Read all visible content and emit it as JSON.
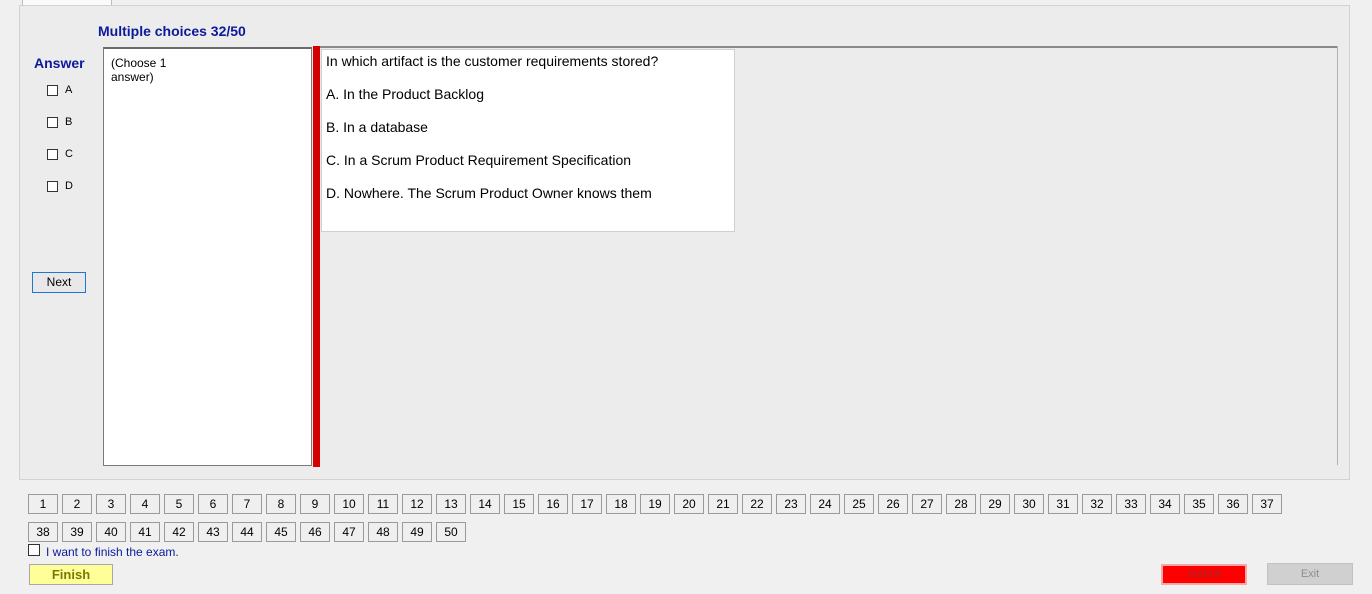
{
  "header": {
    "title": "Multiple choices 32/50"
  },
  "answer": {
    "label": "Answer",
    "options": [
      "A",
      "B",
      "C",
      "D"
    ],
    "next_label": "Next"
  },
  "instruction": "(Choose 1 answer)",
  "question": {
    "text": "In which artifact is the customer requirements stored?",
    "choices": [
      "A.  In the Product Backlog",
      "B.  In a database",
      "C.  In a Scrum Product Requirement Specification",
      "D.  Nowhere. The Scrum Product Owner knows them"
    ]
  },
  "navigation": {
    "row1": [
      "1",
      "2",
      "3",
      "4",
      "5",
      "6",
      "7",
      "8",
      "9",
      "10",
      "11",
      "12",
      "13",
      "14",
      "15",
      "16",
      "17",
      "18",
      "19",
      "20",
      "21",
      "22",
      "23",
      "24",
      "25",
      "26",
      "27",
      "28",
      "29",
      "30",
      "31",
      "32",
      "33",
      "34",
      "35",
      "36",
      "37"
    ],
    "row2": [
      "38",
      "39",
      "40",
      "41",
      "42",
      "43",
      "44",
      "45",
      "46",
      "47",
      "48",
      "49",
      "50"
    ]
  },
  "footer": {
    "finish_check_label": "I want to finish the exam.",
    "finish_label": "Finish",
    "submit_label": "Submit",
    "exit_label": "Exit"
  },
  "colors": {
    "title_blue": "#0a1a9a",
    "red_bar": "#d60000",
    "finish_bg": "#ffff99",
    "submit_bg": "#ff0000",
    "exit_bg": "#d0d0d0"
  }
}
